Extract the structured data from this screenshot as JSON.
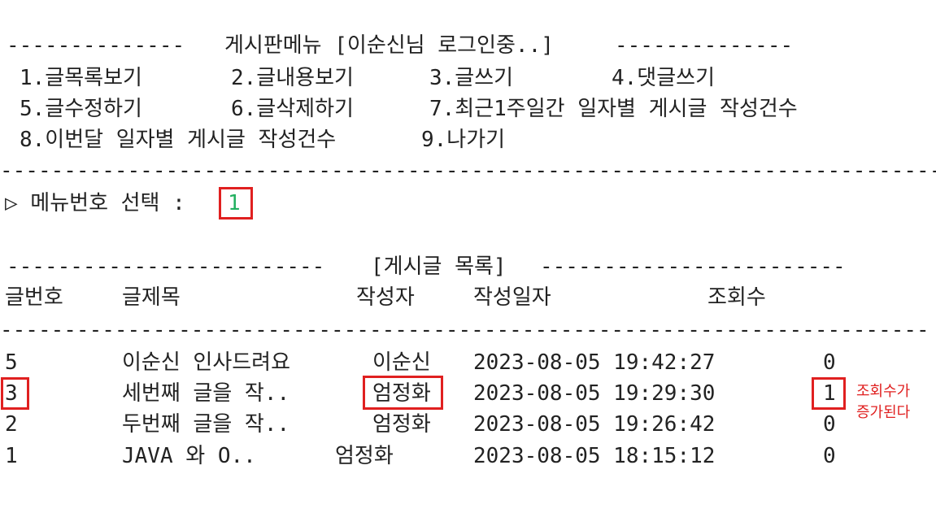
{
  "menu": {
    "header_left": "--------------",
    "title": "게시판메뉴 [이순신님 로그인중..]",
    "header_right": "--------------",
    "items": [
      "1.글목록보기",
      "2.글내용보기",
      "3.글쓰기",
      "4.댓글쓰기",
      "5.글수정하기",
      "6.글삭제하기",
      "7.최근1주일간 일자별 게시글 작성건수",
      "8.이번달 일자별 게시글 작성건수",
      "9.나가기"
    ],
    "separator": "----------------------------------------------------------------------------------------------------"
  },
  "prompt": {
    "label": "▷ 메뉴번호 선택 :",
    "value": "1"
  },
  "list": {
    "header_left": "-------------------------",
    "title": "[게시글 목록]",
    "header_right": "------------------------",
    "columns": [
      "글번호",
      "글제목",
      "작성자",
      "작성일자",
      "조회수"
    ],
    "separator": "----------------------------------------------------------------------------------------------------",
    "rows": [
      {
        "no": "5",
        "title": "이순신 인사드려요",
        "author": "이순신",
        "date": "2023-08-05 19:42:27",
        "views": "0"
      },
      {
        "no": "3",
        "title": "세번째 글을 작..",
        "author": "엄정화",
        "date": "2023-08-05 19:29:30",
        "views": "1"
      },
      {
        "no": "2",
        "title": "두번째 글을 작..",
        "author": "엄정화",
        "date": "2023-08-05 19:26:42",
        "views": "0"
      },
      {
        "no": "1",
        "title": "JAVA 와 O..",
        "author": "엄정화",
        "date": "2023-08-05 18:15:12",
        "views": "0"
      }
    ]
  },
  "annotation": {
    "line1": "조회수가",
    "line2": "증가된다",
    "color": "#e02020"
  }
}
